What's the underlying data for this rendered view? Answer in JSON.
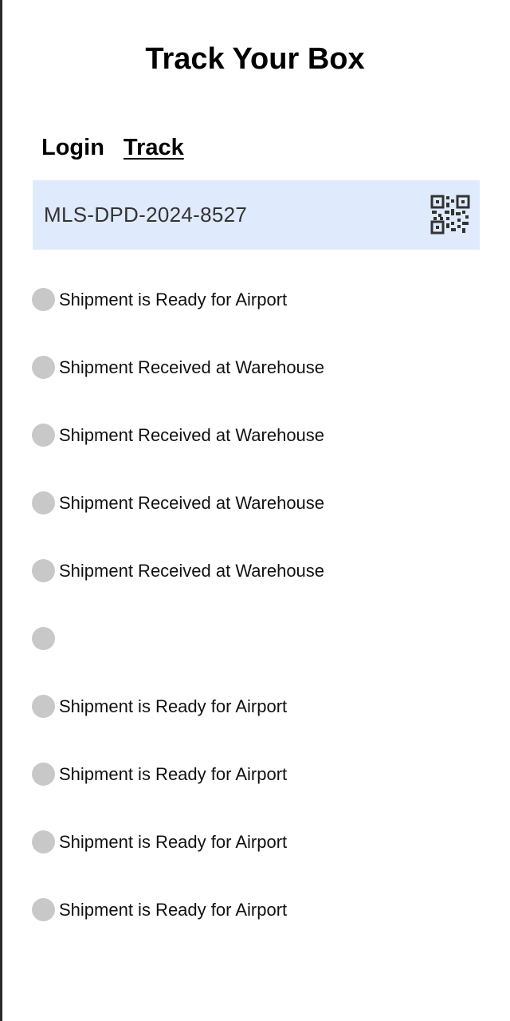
{
  "app": {
    "title": "Track Your Box"
  },
  "nav": {
    "login_label": "Login",
    "track_label": "Track",
    "active": "Track"
  },
  "tracking": {
    "number": "MLS-DPD-2024-8527",
    "scan_icon": "qr-code-icon",
    "field_background": "#dfeafc"
  },
  "timeline": {
    "dot_color": "#c8c8c8",
    "items": [
      {
        "status": "Shipment is Ready for Airport"
      },
      {
        "status": "Shipment Received at Warehouse"
      },
      {
        "status": "Shipment Received at Warehouse"
      },
      {
        "status": "Shipment Received at Warehouse"
      },
      {
        "status": "Shipment Received at Warehouse"
      },
      {
        "status": ""
      },
      {
        "status": "Shipment is Ready for Airport"
      },
      {
        "status": "Shipment is Ready for Airport"
      },
      {
        "status": "Shipment is Ready for Airport"
      },
      {
        "status": "Shipment is Ready for Airport"
      }
    ]
  }
}
